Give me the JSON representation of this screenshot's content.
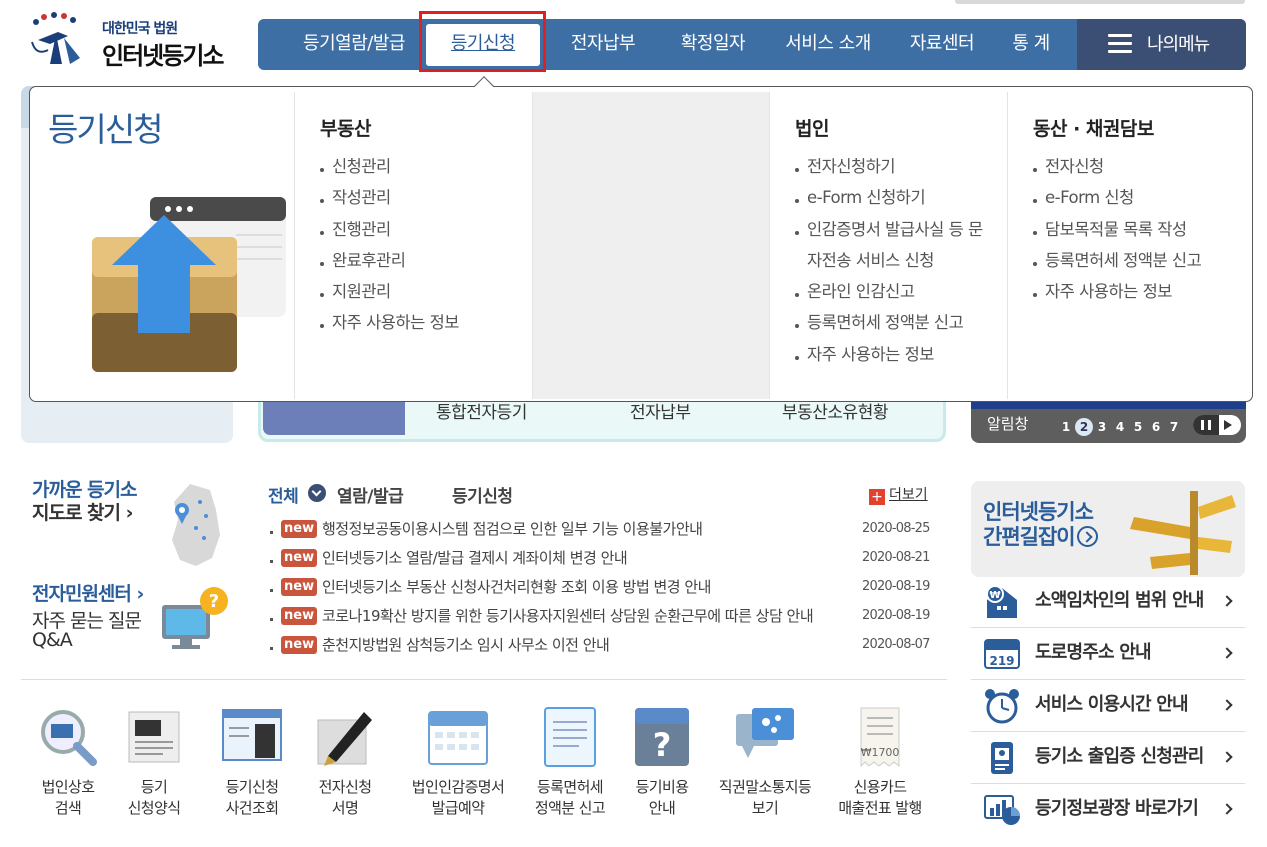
{
  "logo": {
    "small": "대한민국 법원",
    "big": "인터넷등기소"
  },
  "gnb": {
    "items": [
      "등기열람/발급",
      "등기신청",
      "전자납부",
      "확정일자",
      "서비스 소개",
      "자료센터",
      "통 계"
    ],
    "active": "등기신청",
    "mymenu": "나의메뉴"
  },
  "dropdown": {
    "title": "등기신청",
    "columns": [
      {
        "heading": "부동산",
        "items": [
          "신청관리",
          "작성관리",
          "진행관리",
          "완료후관리",
          "지원관리",
          "자주 사용하는 정보"
        ]
      },
      {
        "heading": "법인",
        "items": [
          "전자신청하기",
          "e-Form 신청하기",
          "인감증명서 발급사실 등 문자전송 서비스 신청",
          "온라인 인감신고",
          "등록면허세 정액분 신고",
          "자주 사용하는 정보"
        ]
      },
      {
        "heading": "동산 · 채권담보",
        "items": [
          "전자신청",
          "e-Form 신청",
          "담보목적물 목록 작성",
          "등록면허세 정액분 신고",
          "자주 사용하는 정보"
        ]
      }
    ]
  },
  "quick_links": [
    "통합전자등기",
    "전자납부",
    "부동산소유현황"
  ],
  "alert": {
    "title": "알림창",
    "pages": [
      "1",
      "2",
      "3",
      "4",
      "5",
      "6",
      "7"
    ],
    "current": "2"
  },
  "side": {
    "map_line1": "가까운 등기소",
    "map_line2": "지도로 찾기 ›",
    "center": "전자민원센터 ›",
    "faq_line1": "자주 묻는 질문",
    "faq_line2": "Q&A"
  },
  "news": {
    "tabs": [
      "전체",
      "열람/발급",
      "등기신청"
    ],
    "active_tab": "전체",
    "more": "더보기",
    "badge": "new",
    "items": [
      {
        "title": "행정정보공동이용시스템 점검으로 인한 일부 기능 이용불가안내",
        "date": "2020-08-25"
      },
      {
        "title": "인터넷등기소 열람/발급 결제시 계좌이체 변경 안내",
        "date": "2020-08-21"
      },
      {
        "title": "인터넷등기소 부동산 신청사건처리현황 조회 이용 방법 변경 안내",
        "date": "2020-08-19"
      },
      {
        "title": "코로나19확산 방지를 위한 등기사용자지원센터 상담원 순환근무에 따른 상담 안내",
        "date": "2020-08-19"
      },
      {
        "title": "춘천지방법원 삼척등기소 임시 사무소 이전 안내",
        "date": "2020-08-07"
      }
    ]
  },
  "shortcuts": [
    {
      "label": "법인상호\n검색",
      "icon": "magnifier-icon"
    },
    {
      "label": "등기\n신청양식",
      "icon": "form-icon"
    },
    {
      "label": "등기신청\n사건조회",
      "icon": "case-lookup-icon"
    },
    {
      "label": "전자신청\n서명",
      "icon": "pen-icon"
    },
    {
      "label": "법인인감증명서\n발급예약",
      "icon": "calendar-icon"
    },
    {
      "label": "등록면허세\n정액분 신고",
      "icon": "document-icon"
    },
    {
      "label": "등기비용\n안내",
      "icon": "question-icon"
    },
    {
      "label": "직권말소통지등\n보기",
      "icon": "notice-icon"
    },
    {
      "label": "신용카드\n매출전표 발행",
      "icon": "receipt-icon"
    }
  ],
  "guide": {
    "line1": "인터넷등기소",
    "line2": "간편길잡이"
  },
  "services": [
    {
      "label": "소액임차인의 범위 안내",
      "icon": "house-won-icon"
    },
    {
      "label": "도로명주소 안내",
      "icon": "address-plate-icon"
    },
    {
      "label": "서비스 이용시간 안내",
      "icon": "alarm-clock-icon"
    },
    {
      "label": "등기소 출입증 신청관리",
      "icon": "pass-card-icon"
    },
    {
      "label": "등기정보광장 바로가기",
      "icon": "stats-chart-icon"
    }
  ]
}
